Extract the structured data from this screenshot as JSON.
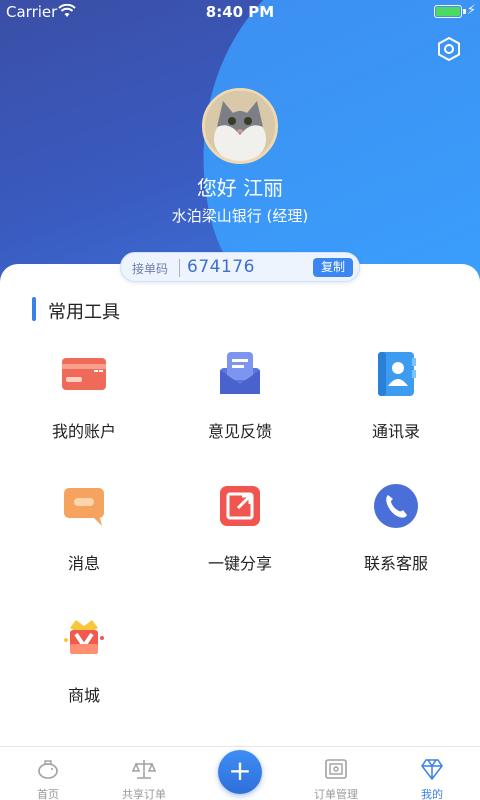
{
  "status_bar": {
    "carrier": "Carrier",
    "time": "8:40 PM",
    "battery_level": 1.0
  },
  "profile": {
    "greeting": "您好 江丽",
    "company": "水泊梁山银行 (经理)"
  },
  "order_code": {
    "label": "接单码",
    "value": "674176",
    "copy_label": "复制"
  },
  "tools": {
    "section_title": "常用工具",
    "items": [
      {
        "label": "我的账户",
        "icon": "card-icon"
      },
      {
        "label": "意见反馈",
        "icon": "feedback-icon"
      },
      {
        "label": "通讯录",
        "icon": "contacts-icon"
      },
      {
        "label": "消息",
        "icon": "message-icon"
      },
      {
        "label": "一键分享",
        "icon": "share-icon"
      },
      {
        "label": "联系客服",
        "icon": "phone-icon"
      },
      {
        "label": "商城",
        "icon": "shop-icon"
      }
    ]
  },
  "tabbar": {
    "items": [
      {
        "label": "首页",
        "icon": "piggy-bank-icon"
      },
      {
        "label": "共享订单",
        "icon": "scale-icon"
      },
      {
        "label": "",
        "icon": "plus-icon"
      },
      {
        "label": "订单管理",
        "icon": "safe-icon"
      },
      {
        "label": "我的",
        "icon": "diamond-icon"
      }
    ],
    "active": "我的"
  },
  "colors": {
    "accent": "#3b7fe8",
    "header_dark": "#3a4fa6",
    "header_light": "#3aa2ff"
  }
}
